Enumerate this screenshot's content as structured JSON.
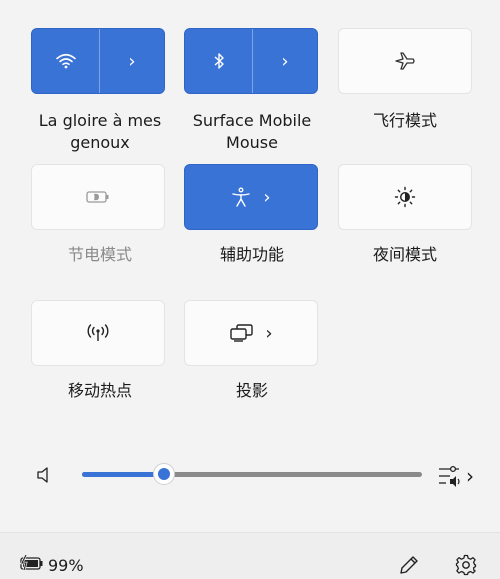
{
  "tiles": [
    {
      "id": "wifi",
      "label": "La gloire à mes genoux",
      "state": "on",
      "icon": "wifi-icon"
    },
    {
      "id": "bluetooth",
      "label": "Surface Mobile Mouse",
      "state": "on",
      "icon": "bluetooth-icon"
    },
    {
      "id": "airplane",
      "label": "飞行模式",
      "state": "off",
      "icon": "airplane-icon"
    },
    {
      "id": "battery-saver",
      "label": "节电模式",
      "state": "disabled",
      "icon": "battery-saver-icon"
    },
    {
      "id": "accessibility",
      "label": "辅助功能",
      "state": "on",
      "icon": "accessibility-icon"
    },
    {
      "id": "night-light",
      "label": "夜间模式",
      "state": "off",
      "icon": "night-light-icon"
    },
    {
      "id": "hotspot",
      "label": "移动热点",
      "state": "off",
      "icon": "hotspot-icon"
    },
    {
      "id": "project",
      "label": "投影",
      "state": "off",
      "icon": "project-icon"
    }
  ],
  "volume": {
    "level_percent": 24,
    "icon": "speaker-icon",
    "output_icon": "audio-output-icon"
  },
  "footer": {
    "battery_percent": "99%",
    "battery_icon": "battery-charging-icon",
    "edit_icon": "pencil-icon",
    "settings_icon": "gear-icon"
  },
  "colors": {
    "accent": "#3a73d6",
    "disabled_text": "#8a8a8a"
  }
}
